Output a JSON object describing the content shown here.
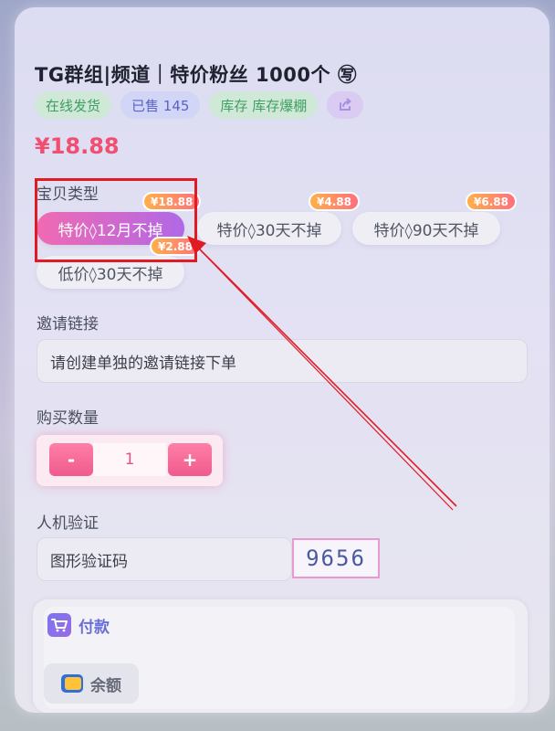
{
  "product": {
    "title": "TG群组|频道｜特价粉丝 1000个 ㊢",
    "tags": {
      "delivery": "在线发货",
      "sold": "已售 145",
      "stock": "库存 库存爆棚"
    },
    "price": "¥18.88"
  },
  "type_section": {
    "label": "宝贝类型",
    "options": [
      {
        "label": "特价◊12月不掉",
        "badge": "¥18.88",
        "badge2": "¥2.88"
      },
      {
        "label": "特价◊30天不掉",
        "badge": "¥4.88"
      },
      {
        "label": "特价◊90天不掉",
        "badge": "¥6.88"
      },
      {
        "label": "低价◊30天不掉"
      }
    ]
  },
  "invite": {
    "label": "邀请链接",
    "placeholder": "请创建单独的邀请链接下单"
  },
  "quantity": {
    "label": "购买数量",
    "minus": "-",
    "value": "1",
    "plus": "+"
  },
  "captcha": {
    "label": "人机验证",
    "placeholder": "图形验证码",
    "image_text": "9656"
  },
  "payment": {
    "title": "付款",
    "balance": "余额"
  },
  "colors": {
    "accent_pink": "#f04f72",
    "annotation_red": "#e01b24"
  }
}
